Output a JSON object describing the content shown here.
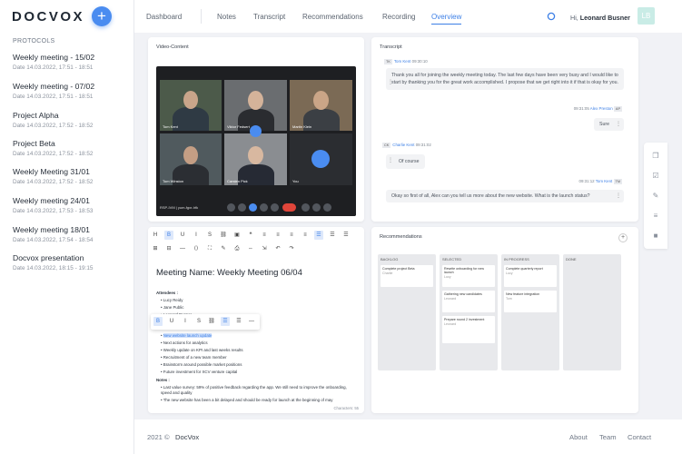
{
  "app": {
    "logo": "DOCVOX",
    "add_label": "+"
  },
  "sidebar": {
    "section_title": "PROTOCOLS",
    "items": [
      {
        "title": "Weekly meeting - 15/02",
        "date": "Date 14.03.2022, 17:51 - 18:51"
      },
      {
        "title": "Weekly meeting - 07/02",
        "date": "Date 14.03.2022, 17:51 - 18:51"
      },
      {
        "title": "Project Alpha",
        "date": "Date 14.03.2022, 17:52 - 18:52"
      },
      {
        "title": "Project Beta",
        "date": "Date 14.03.2022, 17:52 - 18:52"
      },
      {
        "title": "Weekly Meeting 31/01",
        "date": "Date 14.03.2022, 17:52 - 18:52"
      },
      {
        "title": "Weekly meeting 24/01",
        "date": "Date 14.03.2022, 17:53 - 18:53"
      },
      {
        "title": "Weekly meeting 18/01",
        "date": "Date 14.03.2022, 17:54 - 18:54"
      },
      {
        "title": "Docvox presentation",
        "date": "Date 14.03.2022, 18:15 - 19:15"
      }
    ]
  },
  "topnav": {
    "items": [
      "Dashboard",
      "Notes",
      "Transcript",
      "Recommendations",
      "Recording",
      "Overview"
    ],
    "active": "Overview",
    "greeting": "Hi,",
    "user_name": "Leonard Busner",
    "avatar_initials": "LB"
  },
  "video": {
    "title": "Video-Content",
    "participants": [
      "Tom Kent",
      "Viktor Fedsert",
      "Martin Klein",
      "Tom Winston",
      "Carsten Pick",
      "You"
    ],
    "meeting_code": "RSP-IVM | yum-fgxr-hfk"
  },
  "transcript": {
    "title": "Transcript",
    "messages": [
      {
        "badge": "TK",
        "name": "Tom Kent",
        "time": "09:30:10",
        "side": "left",
        "text": "Thank you all for joining the weekly meeting today. The last few days have been very busy and I would like to start by thanking you for the great work accomplished. I propose that we get right into it if that is okay for you."
      },
      {
        "badge": "AP",
        "name": "Alex Preston",
        "time": "09:31:05",
        "side": "right",
        "text": "Sure"
      },
      {
        "badge": "CK",
        "name": "Charlie Kent",
        "time": "09:31:02",
        "side": "left",
        "text": "Of course"
      },
      {
        "badge": "TM",
        "name": "Tom Kent",
        "time": "09:31:12",
        "side": "right",
        "text": "Okay so first of all, Alex can you tell us more about the new website. What is the launch status?"
      }
    ]
  },
  "notes": {
    "title": "Meeting Name: Weekly Meeting 06/04",
    "attendees_label": "Attendees :",
    "attendees": [
      "Lucy Reidy",
      "Jane Public",
      "Leonard Busner"
    ],
    "agenda": [
      "New website launch update",
      "Next actions for analytics",
      "Weekly update on KPI and last weeks results",
      "Recruitment of a new team member",
      "Brainstorm around possible market positions",
      "Future investment for XCV venture capital"
    ],
    "notes_label": "Notes :",
    "notes": [
      "Last value survey: 59% of positive feedback regarding the app. We still need to improve the onboarding, speed and quality",
      "The new website has been a bit delayed and should be ready for launch at the beginning of may"
    ],
    "char_count": "Characters: 55"
  },
  "recommendations": {
    "title": "Recommendations",
    "add_label": "+",
    "columns": [
      {
        "name": "BACKLOG",
        "tasks": [
          {
            "title": "Complete project Beta",
            "owner": "Charlie"
          }
        ]
      },
      {
        "name": "SELECTED",
        "tasks": [
          {
            "title": "Rewrite onboarding for new launch",
            "owner": "Lucy"
          },
          {
            "title": "Gathering new candidates",
            "owner": "Leonard"
          },
          {
            "title": "Prepare round 2 investment",
            "owner": "Leonard"
          }
        ]
      },
      {
        "name": "IN PROGRESS",
        "tasks": [
          {
            "title": "Complete quarterly report",
            "owner": "Lucy"
          },
          {
            "title": "New feature integration",
            "owner": "Tom"
          }
        ]
      },
      {
        "name": "DONE",
        "tasks": []
      }
    ]
  },
  "footer": {
    "copyright": "2021 ©",
    "brand": "DocVox",
    "links": [
      "About",
      "Team",
      "Contact"
    ]
  },
  "colors": {
    "accent": "#3c7fe6",
    "brand_button": "#4a8cf0",
    "avatar": "#c9ece6"
  }
}
